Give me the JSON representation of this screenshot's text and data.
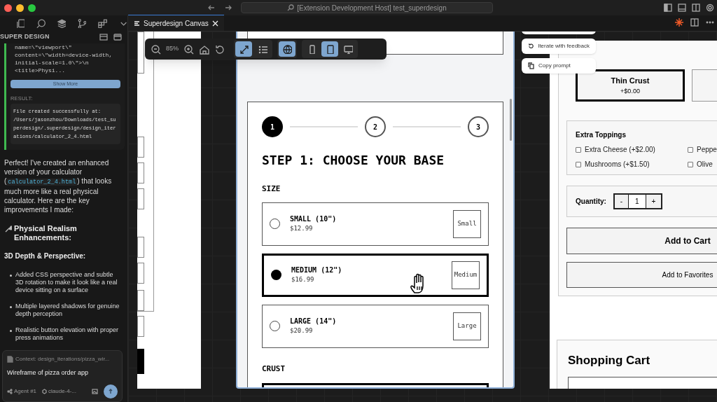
{
  "title_bar": {
    "title": "[Extension Development Host] test_superdesign"
  },
  "sidebar": {
    "title": "SUPER DESIGN",
    "tool_output": {
      "code_lines": [
        "name=\\\"viewport\\\"",
        "content=\\\"width=device-width,",
        "initial-scale=1.0\\\">\\n",
        "<title>Physi..."
      ],
      "button": "Show More",
      "result_label": "RESULT:",
      "result_lines": [
        "File created successfully at:",
        "/Users/jasonzhou/Downloads/test_su",
        "perdesign/.superdesign/design_iter",
        "ations/calculator_2_4.html"
      ]
    },
    "message": {
      "parts": [
        {
          "kind": "text",
          "text": "Perfect! I've created an enhanced version of your calculator ("
        },
        {
          "kind": "code",
          "text": "calculator_2_4.html"
        },
        {
          "kind": "text",
          "text": ") that looks much more like a real physical calculator. Here are the key improvements I made:"
        }
      ],
      "heading": "Physical Realism Enhancements:",
      "subheading": "3D Depth & Perspective:",
      "bullets": [
        "Added CSS perspective and subtle 3D rotation to make it look like a real device sitting on a surface",
        "Multiple layered shadows for genuine depth perception",
        "Realistic button elevation with proper press animations"
      ]
    },
    "chat": {
      "context": "Context: design_iterations/pizza_wir...",
      "input": "Wireframe of pizza order app",
      "agent": "Agent #1",
      "model": "claude-4-..."
    }
  },
  "tab": {
    "label": "Superdesign Canvas",
    "selected": true
  },
  "toolbar": {
    "zoom": "85%",
    "view_buttons": [
      {
        "kind": "expand",
        "selected": true
      },
      {
        "kind": "list",
        "selected": false
      }
    ],
    "globe": {
      "selected": true
    },
    "devices": [
      {
        "kind": "mobile",
        "selected": false
      },
      {
        "kind": "tablet",
        "selected": true
      },
      {
        "kind": "desktop",
        "selected": false
      }
    ]
  },
  "frame_menu": {
    "items": [
      {
        "kind": "iterate",
        "label": "Iterate with feedback"
      },
      {
        "kind": "copy",
        "label": "Copy prompt"
      }
    ]
  },
  "mobile_frame": {
    "steps": [
      {
        "label": "1",
        "selected": true
      },
      {
        "label": "2",
        "selected": false
      },
      {
        "label": "3",
        "selected": false
      }
    ],
    "heading": "STEP 1: CHOOSE YOUR BASE",
    "size_label": "SIZE",
    "sizes": [
      {
        "name": "SMALL (10\")",
        "price": "$12.99",
        "image_alt": "Small",
        "selected": false
      },
      {
        "name": "MEDIUM (12\")",
        "price": "$16.99",
        "image_alt": "Medium",
        "selected": true
      },
      {
        "name": "LARGE (14\")",
        "price": "$20.99",
        "image_alt": "Large",
        "selected": false
      }
    ],
    "crust_label": "CRUST"
  },
  "desktop_frame": {
    "crust_options": [
      {
        "name": "Thin Crust",
        "price": "+$0.00",
        "selected": true
      }
    ],
    "toppings_title": "Extra Toppings",
    "toppings": [
      {
        "label": "Extra Cheese (+$2.00)",
        "checked": false
      },
      {
        "label": "Peppe",
        "checked": false
      },
      {
        "label": "Mushrooms (+$1.50)",
        "checked": false
      },
      {
        "label": "Olive",
        "checked": false
      }
    ],
    "quantity_label": "Quantity:",
    "quantity": "1",
    "minus": "-",
    "plus": "+",
    "add_to_cart": "Add to Cart",
    "add_to_favorites": "Add to Favorites",
    "cart_title": "Shopping Cart"
  }
}
